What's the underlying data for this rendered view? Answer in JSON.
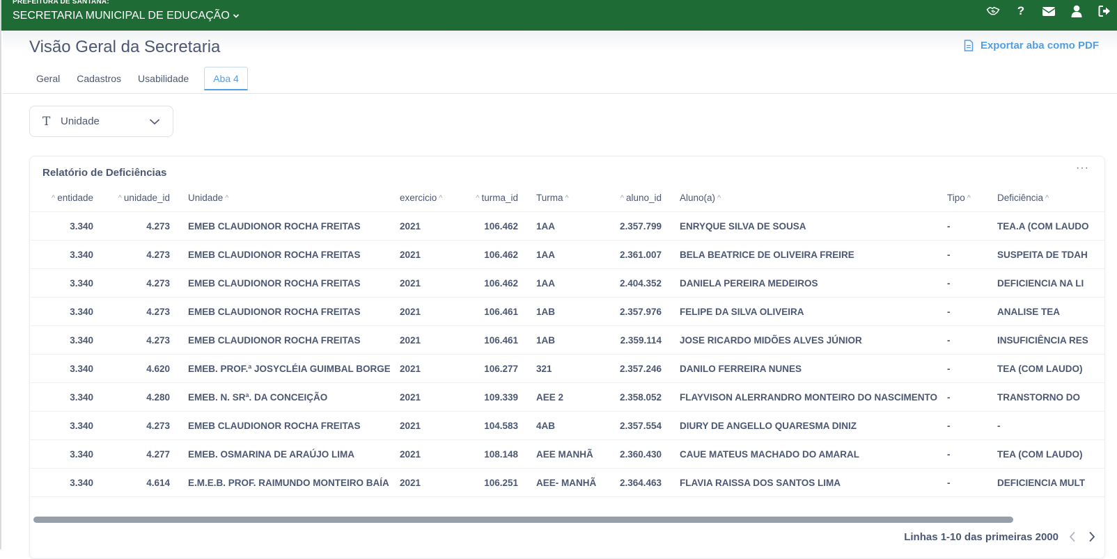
{
  "topbar": {
    "org": "PREFEITURA DE SANTANA:",
    "secretaria": "SECRETARIA MUNICIPAL DE EDUCAÇÃO",
    "icons": [
      "handshake-icon",
      "help-icon",
      "mail-icon",
      "user-icon",
      "logout-icon"
    ],
    "help_glyph": "?"
  },
  "page": {
    "title": "Visão Geral da Secretaria",
    "export_label": "Exportar aba como PDF"
  },
  "tabs": [
    {
      "label": "Geral",
      "active": false
    },
    {
      "label": "Cadastros",
      "active": false
    },
    {
      "label": "Usabilidade",
      "active": false
    },
    {
      "label": "Aba 4",
      "active": true
    }
  ],
  "filter": {
    "type_glyph": "T",
    "label": "Unidade"
  },
  "card": {
    "title": "Relatório de Deficiências",
    "menu_glyph": "···"
  },
  "table": {
    "headers": [
      "entidade",
      "unidade_id",
      "Unidade",
      "exercicio",
      "turma_id",
      "Turma",
      "aluno_id",
      "Aluno(a)",
      "Tipo",
      "Deficiência"
    ],
    "sort_caret": "^",
    "rows": [
      [
        "3.340",
        "4.273",
        "EMEB CLAUDIONOR ROCHA FREITAS",
        "2021",
        "106.462",
        "1AA",
        "2.357.799",
        "ENRYQUE SILVA DE SOUSA",
        "-",
        "TEA.A (COM LAUDO"
      ],
      [
        "3.340",
        "4.273",
        "EMEB CLAUDIONOR ROCHA FREITAS",
        "2021",
        "106.462",
        "1AA",
        "2.361.007",
        "BELA BEATRICE DE OLIVEIRA FREIRE",
        "-",
        "SUSPEITA DE TDAH"
      ],
      [
        "3.340",
        "4.273",
        "EMEB CLAUDIONOR ROCHA FREITAS",
        "2021",
        "106.462",
        "1AA",
        "2.404.352",
        "DANIELA PEREIRA MEDEIROS",
        "-",
        "DEFICIENCIA NA LI"
      ],
      [
        "3.340",
        "4.273",
        "EMEB CLAUDIONOR ROCHA FREITAS",
        "2021",
        "106.461",
        "1AB",
        "2.357.976",
        "FELIPE DA SILVA OLIVEIRA",
        "-",
        "ANALISE TEA"
      ],
      [
        "3.340",
        "4.273",
        "EMEB CLAUDIONOR ROCHA FREITAS",
        "2021",
        "106.461",
        "1AB",
        "2.359.114",
        "JOSE RICARDO MIDÕES ALVES JÚNIOR",
        "-",
        "INSUFICIÊNCIA RES"
      ],
      [
        "3.340",
        "4.620",
        "EMEB. PROF.ª JOSYCLÉIA GUIMBAL BORGES",
        "2021",
        "106.277",
        "321",
        "2.357.246",
        "DANILO FERREIRA NUNES",
        "-",
        "TEA (COM LAUDO)"
      ],
      [
        "3.340",
        "4.280",
        "EMEB. N. SRª. DA CONCEIÇÃO",
        "2021",
        "109.339",
        "AEE 2",
        "2.358.052",
        "FLAYVISON ALERRANDRO MONTEIRO DO NASCIMENTO",
        "-",
        "TRANSTORNO DO"
      ],
      [
        "3.340",
        "4.273",
        "EMEB CLAUDIONOR ROCHA FREITAS",
        "2021",
        "104.583",
        "4AB",
        "2.357.554",
        "DIURY DE ANGELLO QUARESMA DINIZ",
        "-",
        "-"
      ],
      [
        "3.340",
        "4.277",
        "EMEB. OSMARINA DE ARAÚJO LIMA",
        "2021",
        "108.148",
        "AEE MANHÃ",
        "2.360.430",
        "CAUE MATEUS MACHADO DO AMARAL",
        "-",
        "TEA (COM LAUDO)"
      ],
      [
        "3.340",
        "4.614",
        "E.M.E.B. PROF. RAIMUNDO MONTEIRO BAÍA",
        "2021",
        "106.251",
        "AEE- MANHÃ",
        "2.364.463",
        "FLAVIA RAISSA DOS SANTOS LIMA",
        "-",
        "DEFICIENCIA MULT"
      ]
    ]
  },
  "pagination": {
    "summary": "Linhas 1-10 das primeiras 2000"
  }
}
